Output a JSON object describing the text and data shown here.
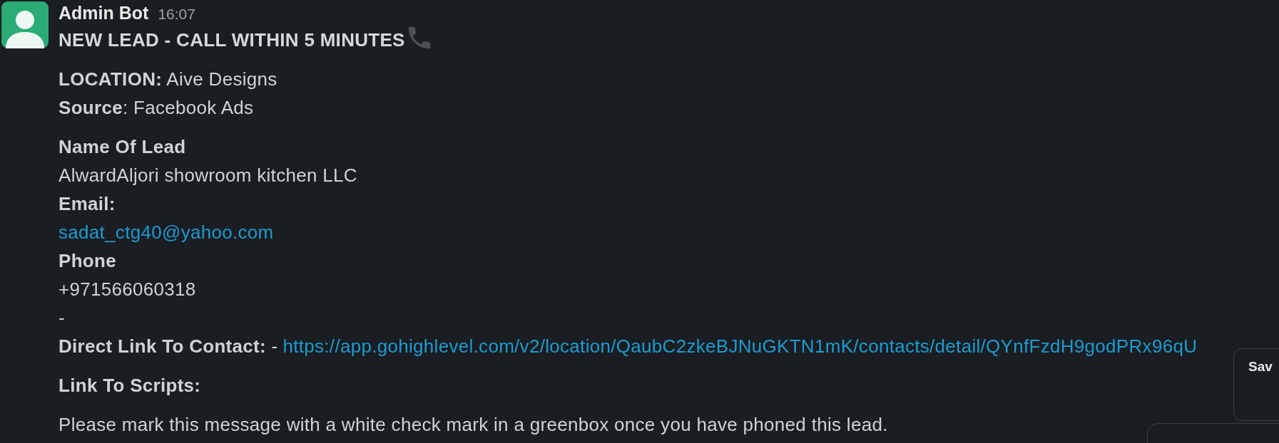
{
  "message": {
    "sender": "Admin Bot",
    "time": "16:07",
    "title": "NEW LEAD - CALL WITHIN 5 MINUTES"
  },
  "blocks": [
    {
      "lines": [
        {
          "kind": "text",
          "text": "**LOCATION:** Aive Designs"
        },
        {
          "kind": "text",
          "text": "**Source**: Facebook Ads"
        }
      ]
    },
    {
      "lines": [
        {
          "kind": "heading",
          "text": "Name Of Lead"
        },
        {
          "kind": "text",
          "text": "AlwardAljori showroom kitchen LLC"
        },
        {
          "kind": "heading",
          "text": "Email:"
        },
        {
          "kind": "link",
          "text": "sadat_ctg40@yahoo.com"
        },
        {
          "kind": "heading",
          "text": "Phone"
        },
        {
          "kind": "text",
          "text": "+971566060318"
        },
        {
          "kind": "text",
          "text": "-"
        },
        {
          "kind": "labeled_link",
          "label": "**Direct Link To Contact:** -",
          "link": "https://app.gohighlevel.com/v2/location/QaubC2zkeBJNuGKTN1mK/contacts/detail/QYnfFzdH9godPRx96qU"
        }
      ]
    },
    {
      "lines": [
        {
          "kind": "heading",
          "text": "Link To Scripts:"
        }
      ]
    },
    {
      "lines": [
        {
          "kind": "text",
          "text": "Please mark this message with a white check mark in a greenbox once you have phoned this lead."
        }
      ]
    }
  ],
  "overlays": [
    {
      "kind": "menu",
      "label": "Sav"
    },
    {
      "kind": "panel"
    }
  ]
}
